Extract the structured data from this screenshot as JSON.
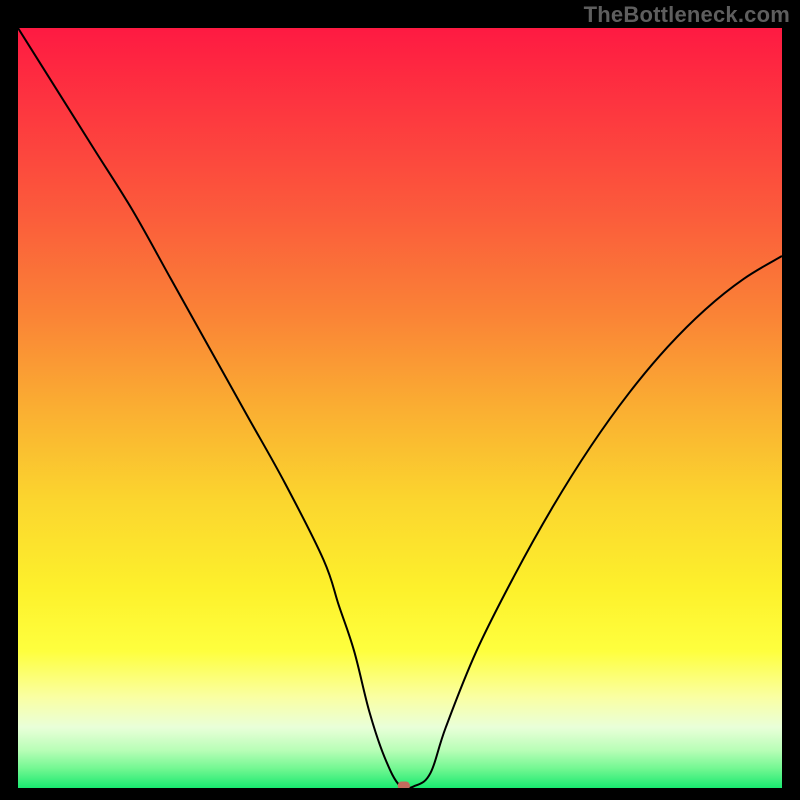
{
  "watermark": "TheBottleneck.com",
  "chart_data": {
    "type": "line",
    "title": "",
    "xlabel": "",
    "ylabel": "",
    "xlim": [
      0,
      100
    ],
    "ylim": [
      0,
      100
    ],
    "grid": false,
    "background": "rainbow_gradient_red_to_green_vertical",
    "series": [
      {
        "name": "curve",
        "x": [
          0,
          5,
          10,
          15,
          20,
          25,
          30,
          35,
          40,
          42,
          44,
          46,
          48,
          50,
          52,
          54,
          56,
          60,
          65,
          70,
          75,
          80,
          85,
          90,
          95,
          100
        ],
        "y": [
          100,
          92,
          84,
          76,
          67,
          58,
          49,
          40,
          30,
          24,
          18,
          10,
          4,
          0.3,
          0.3,
          2,
          8,
          18,
          28,
          37,
          45,
          52,
          58,
          63,
          67,
          70
        ],
        "color": "#000000",
        "linewidth": 2
      }
    ],
    "marker": {
      "name": "optimal-point",
      "x": 50.5,
      "y": 0.3,
      "color": "#c46a5d",
      "shape": "rounded-rect",
      "width": 1.6,
      "height": 1.1
    },
    "gradient_stops": [
      {
        "offset": 0.0,
        "color": "#fe1a42"
      },
      {
        "offset": 0.12,
        "color": "#fd3a3f"
      },
      {
        "offset": 0.25,
        "color": "#fb5d3b"
      },
      {
        "offset": 0.38,
        "color": "#fa8436"
      },
      {
        "offset": 0.5,
        "color": "#faae32"
      },
      {
        "offset": 0.62,
        "color": "#fbd52e"
      },
      {
        "offset": 0.74,
        "color": "#fdf12c"
      },
      {
        "offset": 0.82,
        "color": "#feff3e"
      },
      {
        "offset": 0.88,
        "color": "#faffa2"
      },
      {
        "offset": 0.92,
        "color": "#e9ffd9"
      },
      {
        "offset": 0.95,
        "color": "#b9feb7"
      },
      {
        "offset": 0.975,
        "color": "#71f791"
      },
      {
        "offset": 1.0,
        "color": "#19e970"
      }
    ]
  }
}
